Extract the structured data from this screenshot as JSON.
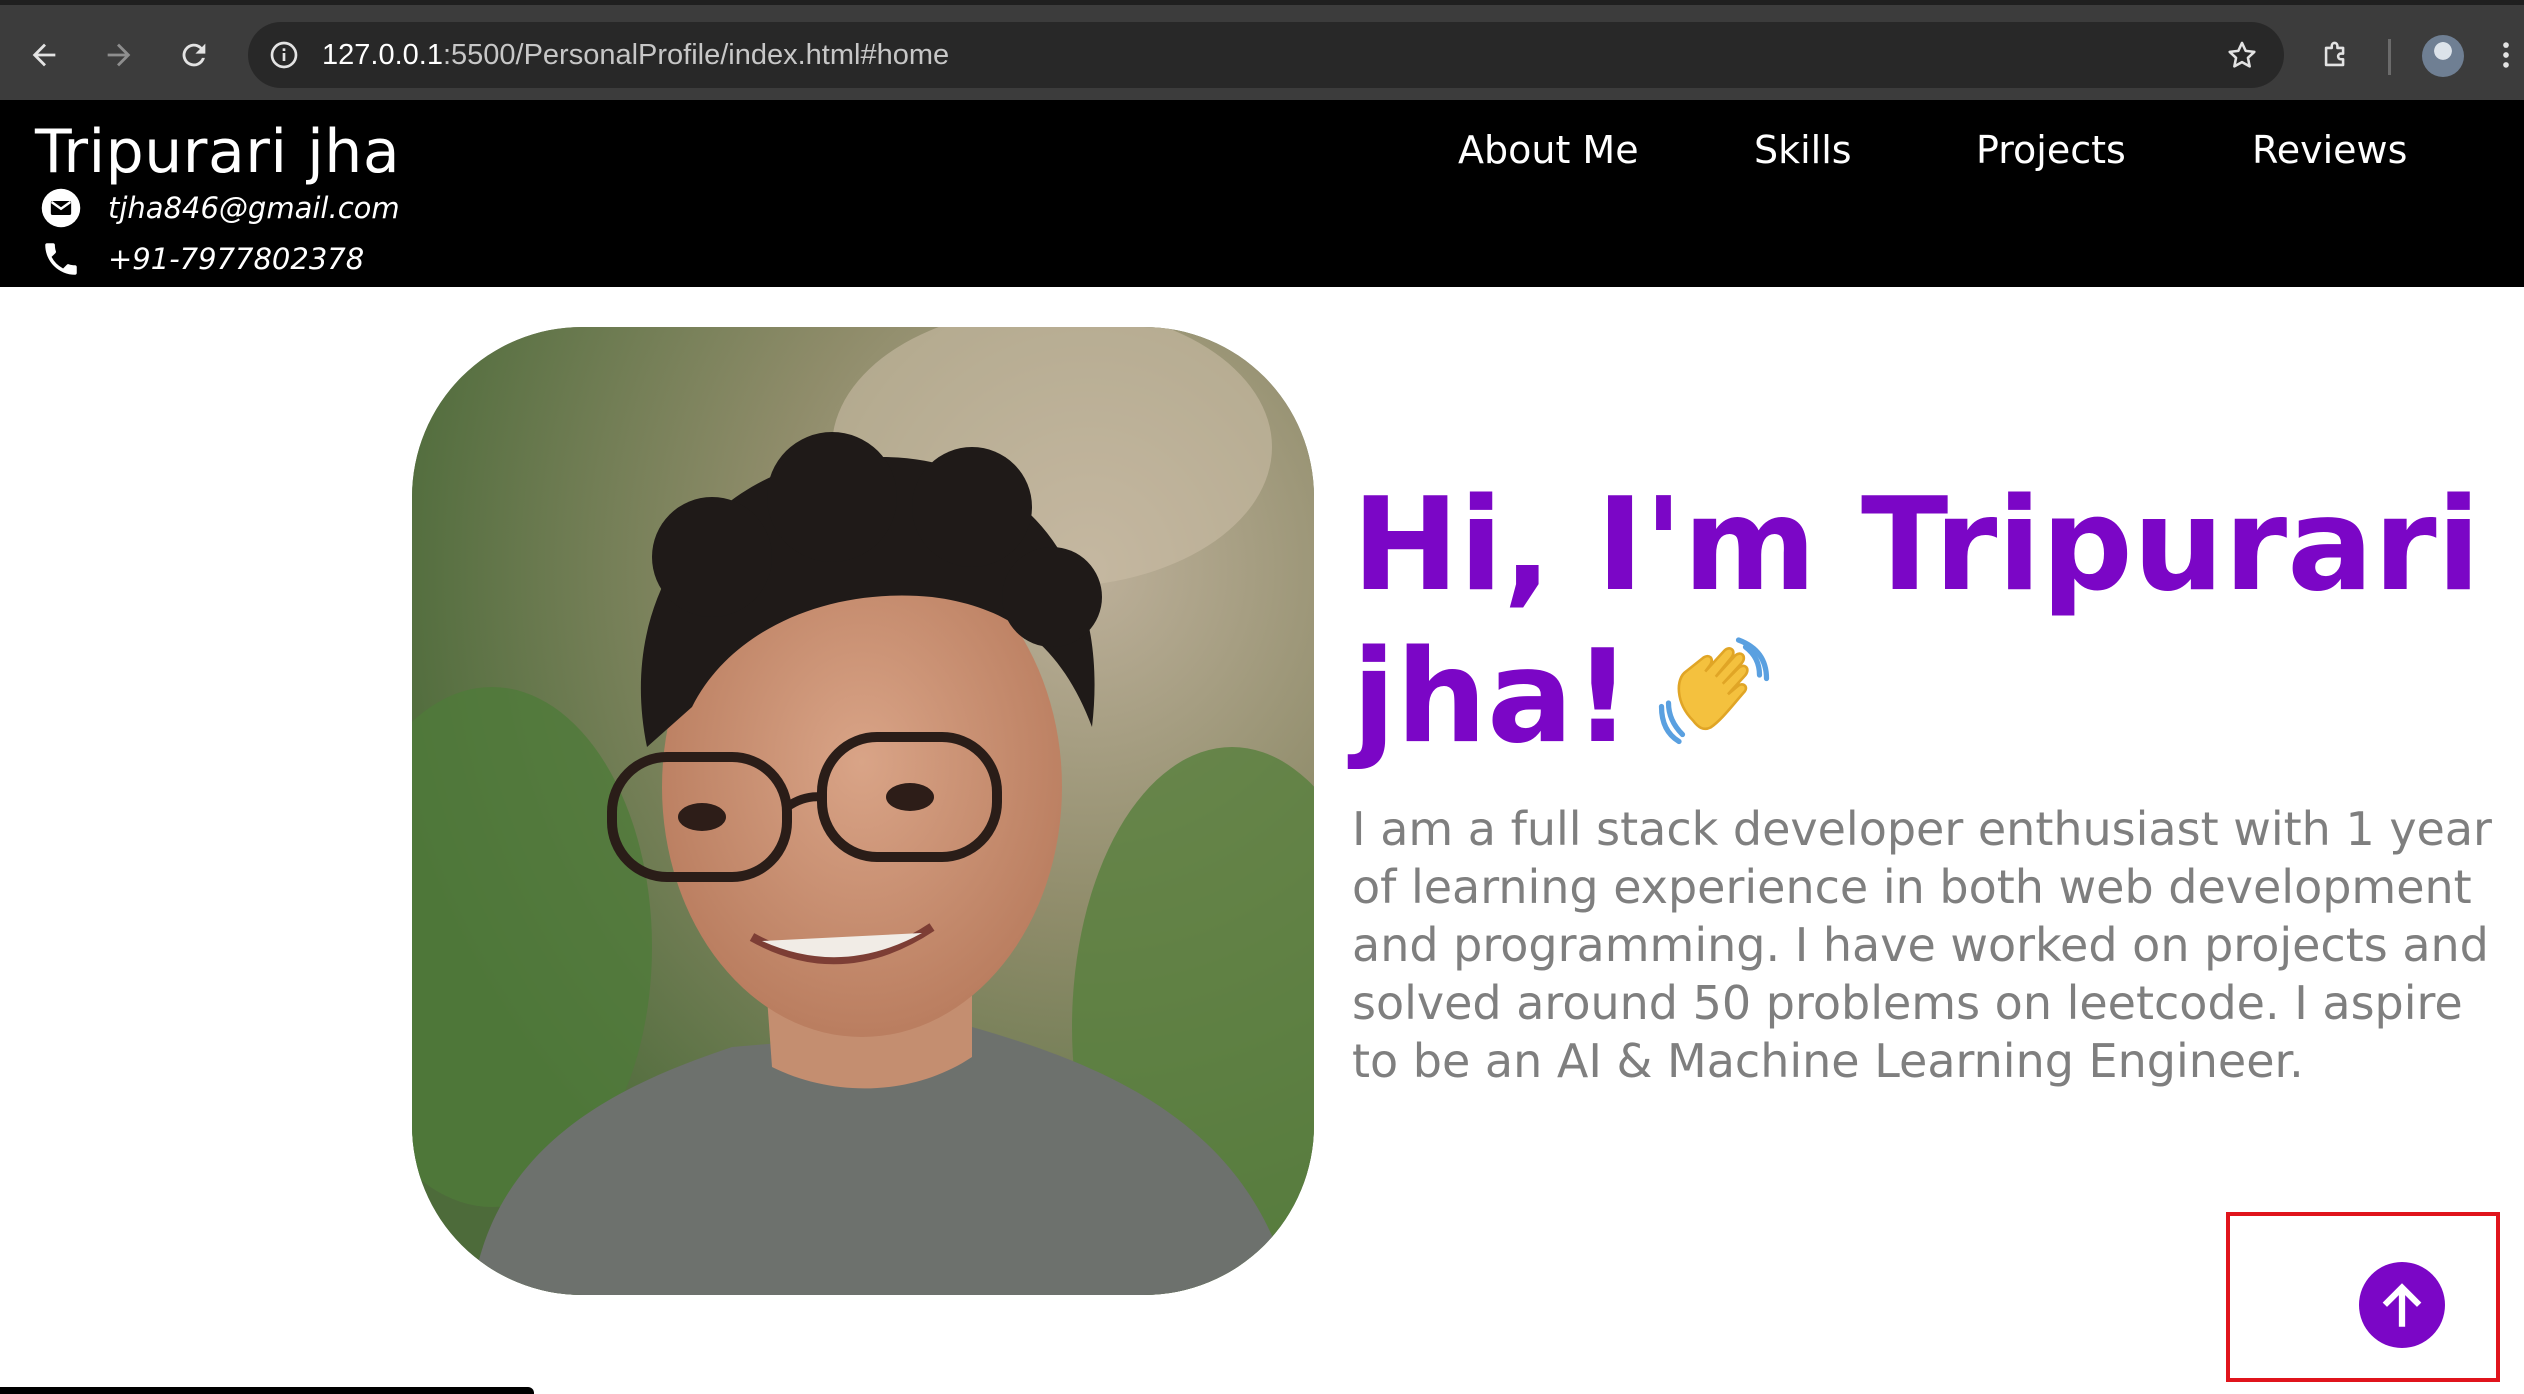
{
  "browser": {
    "url_host": "127.0.0.1",
    "url_rest": ":5500/PersonalProfile/index.html#home",
    "icons": [
      "back-arrow-icon",
      "forward-arrow-icon",
      "reload-icon",
      "site-info-icon",
      "bookmark-star-icon",
      "extensions-puzzle-icon",
      "profile-avatar",
      "kebab-menu-icon"
    ]
  },
  "header": {
    "brand": "Tripurari jha",
    "email": "tjha846@gmail.com",
    "phone": "+91-7977802378",
    "nav": [
      "About Me",
      "Skills",
      "Projects",
      "Reviews"
    ]
  },
  "hero": {
    "title_line1": "Hi, I'm Tripurari",
    "title_line2": "jha!",
    "emoji": "waving-hand",
    "bio": "I am a full stack developer enthusiast with 1 year of learning experience in both web development and programming. I have worked on projects and solved around 50 problems on leetcode. I aspire to be an AI & Machine Learning Engineer."
  },
  "colors": {
    "accent": "#7b06c6",
    "header_bg": "#000000",
    "bio_text": "#7f7f7f",
    "highlight": "#e0141c"
  }
}
